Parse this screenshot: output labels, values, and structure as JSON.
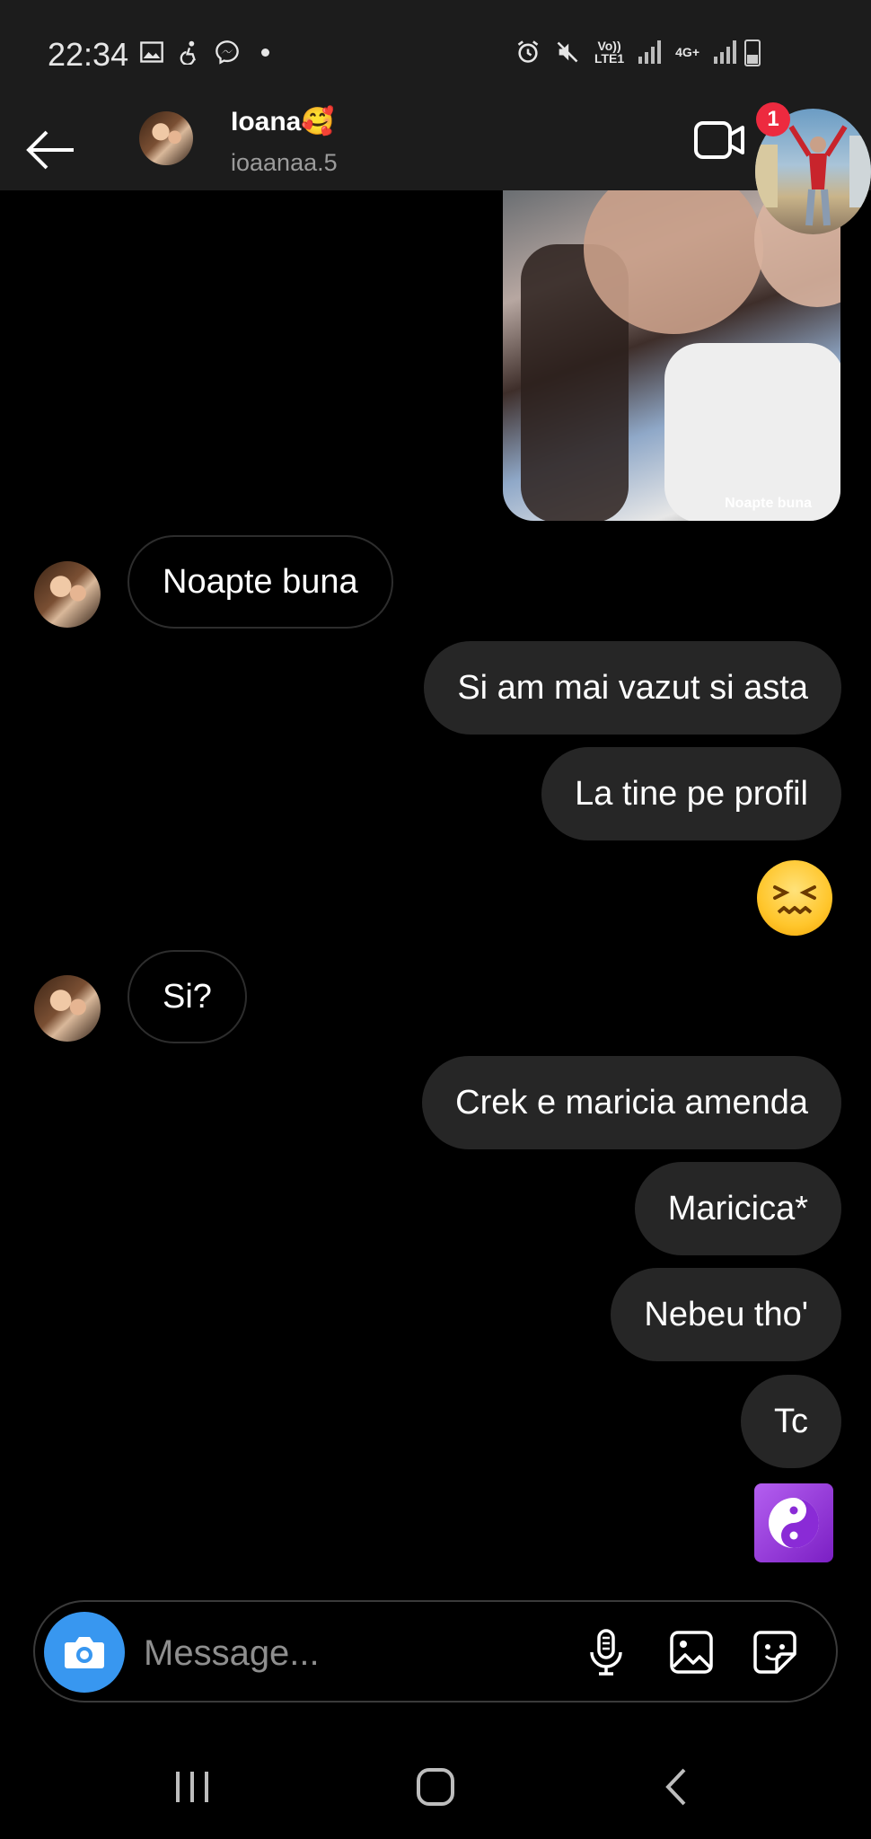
{
  "status_bar": {
    "time": "22:34",
    "network_top": "Vo))",
    "network_bottom": "LTE1",
    "network2": "4G+"
  },
  "header": {
    "name": "Ioana🥰",
    "username": "ioaanaa.5",
    "notification_count": "1"
  },
  "media_message": {
    "caption": "Noapte buna"
  },
  "messages": [
    {
      "from": "them",
      "text": "Noapte buna"
    },
    {
      "from": "me",
      "text": "Si am mai vazut si asta"
    },
    {
      "from": "me",
      "text": "La tine pe profil"
    },
    {
      "from": "me",
      "emoji": "confounded-face"
    },
    {
      "from": "them",
      "text": "Si?"
    },
    {
      "from": "me",
      "text": "Crek e maricia amenda"
    },
    {
      "from": "me",
      "text": "Maricica*"
    },
    {
      "from": "me",
      "text": "Nebeu tho'"
    },
    {
      "from": "me",
      "text": "Tc"
    },
    {
      "from": "me",
      "emoji": "yin-yang"
    }
  ],
  "composer": {
    "placeholder": "Message..."
  },
  "colors": {
    "background": "#000000",
    "bar": "#1c1c1c",
    "outgoing_bubble": "#262626",
    "camera_button": "#3897f0",
    "badge": "#ed2a3f"
  }
}
